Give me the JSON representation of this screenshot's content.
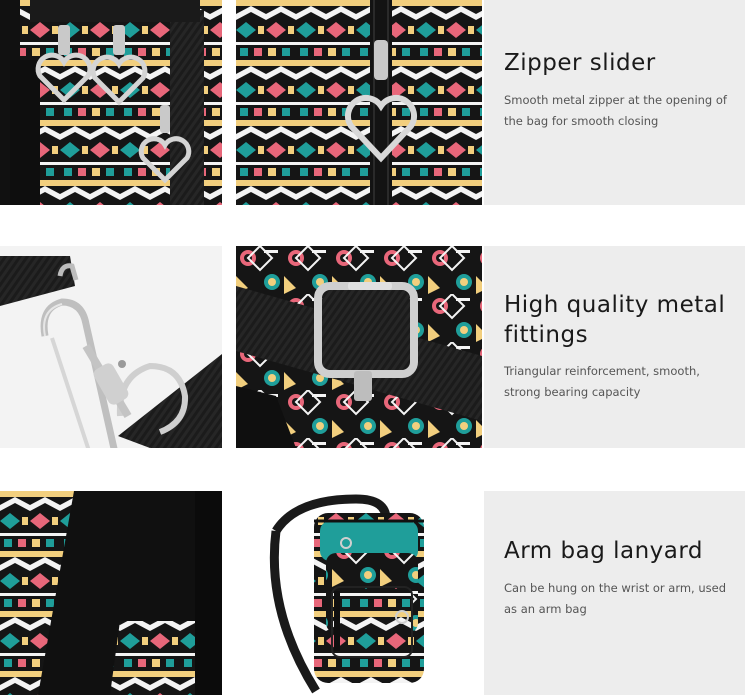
{
  "features": [
    {
      "title": "Zipper slider",
      "description": "Smooth metal zipper at the opening of the bag for smooth closing"
    },
    {
      "title": "High quality metal fittings",
      "description": "Triangular reinforcement, smooth, strong bearing capacity"
    },
    {
      "title": "Arm bag lanyard",
      "description": "Can be hung on the wrist or arm, used as an arm bag"
    }
  ],
  "colors": {
    "panel_bg": "#ededed",
    "pattern_black": "#151515",
    "pattern_teal": "#1f9e9a",
    "pattern_coral": "#e8677a",
    "pattern_yellow": "#f2cf7e",
    "pattern_white": "#f4f4f4",
    "metal": "#c9c9c9"
  },
  "icons": [
    "heart-zipper-pull-icon",
    "buckle-icon",
    "swivel-hook-icon",
    "crossbody-bag-icon"
  ]
}
